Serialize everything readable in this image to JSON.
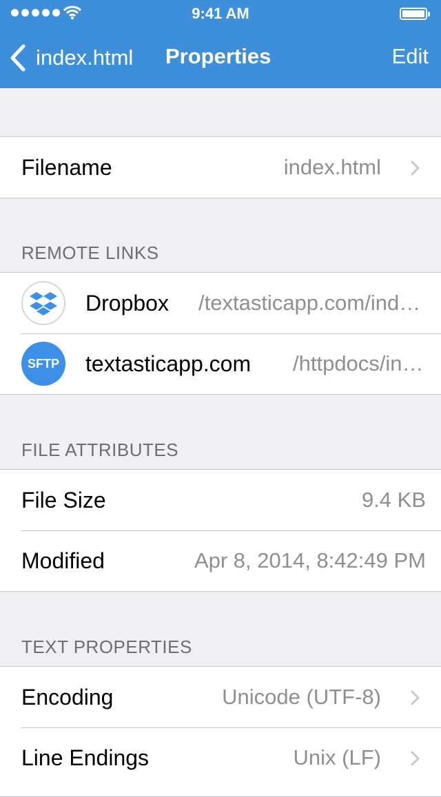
{
  "status_bar": {
    "time": "9:41 AM"
  },
  "nav": {
    "back_label": "index.html",
    "title": "Properties",
    "edit_label": "Edit"
  },
  "filename_row": {
    "label": "Filename",
    "value": "index.html"
  },
  "remote_links": {
    "header": "REMOTE LINKS",
    "items": [
      {
        "icon": "dropbox-icon",
        "name": "Dropbox",
        "path": "/textasticapp.com/index.html"
      },
      {
        "icon": "sftp-icon",
        "icon_text": "SFTP",
        "name": "textasticapp.com",
        "path": "/httpdocs/index.html"
      }
    ]
  },
  "file_attributes": {
    "header": "FILE ATTRIBUTES",
    "size_label": "File Size",
    "size_value": "9.4 KB",
    "modified_label": "Modified",
    "modified_value": "Apr 8, 2014, 8:42:49 PM"
  },
  "text_properties": {
    "header": "TEXT PROPERTIES",
    "encoding_label": "Encoding",
    "encoding_value": "Unicode (UTF-8)",
    "line_endings_label": "Line Endings",
    "line_endings_value": "Unix (LF)"
  },
  "colors": {
    "nav_bar": "#3d8fd9",
    "background": "#efeff4",
    "sftp_badge": "#3d8fe8",
    "secondary_text": "#8e8e93"
  }
}
